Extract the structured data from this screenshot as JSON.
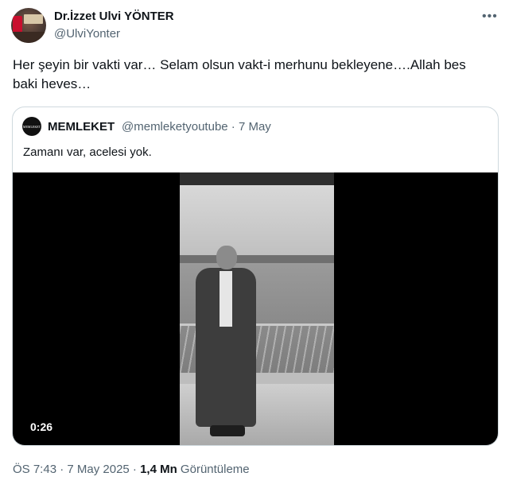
{
  "author": {
    "name": "Dr.İzzet Ulvi YÖNTER",
    "handle": "@UlviYonter"
  },
  "more_icon": "more-horizontal-icon",
  "tweet": {
    "text": "Her şeyin bir vakti var… Selam olsun vakt-i merhunu bekleyene….Allah bes baki heves…"
  },
  "quoted": {
    "name": "MEMLEKET",
    "avatar_text": "MEMLEKET",
    "meta": "@memleketyoutube · 7 May",
    "text": "Zamanı var, acelesi yok.",
    "video_duration": "0:26"
  },
  "footer": {
    "time_date": "ÖS 7:43 · 7 May 2025 · ",
    "views_count": "1,4 Mn",
    "views_label": " Görüntüleme"
  }
}
